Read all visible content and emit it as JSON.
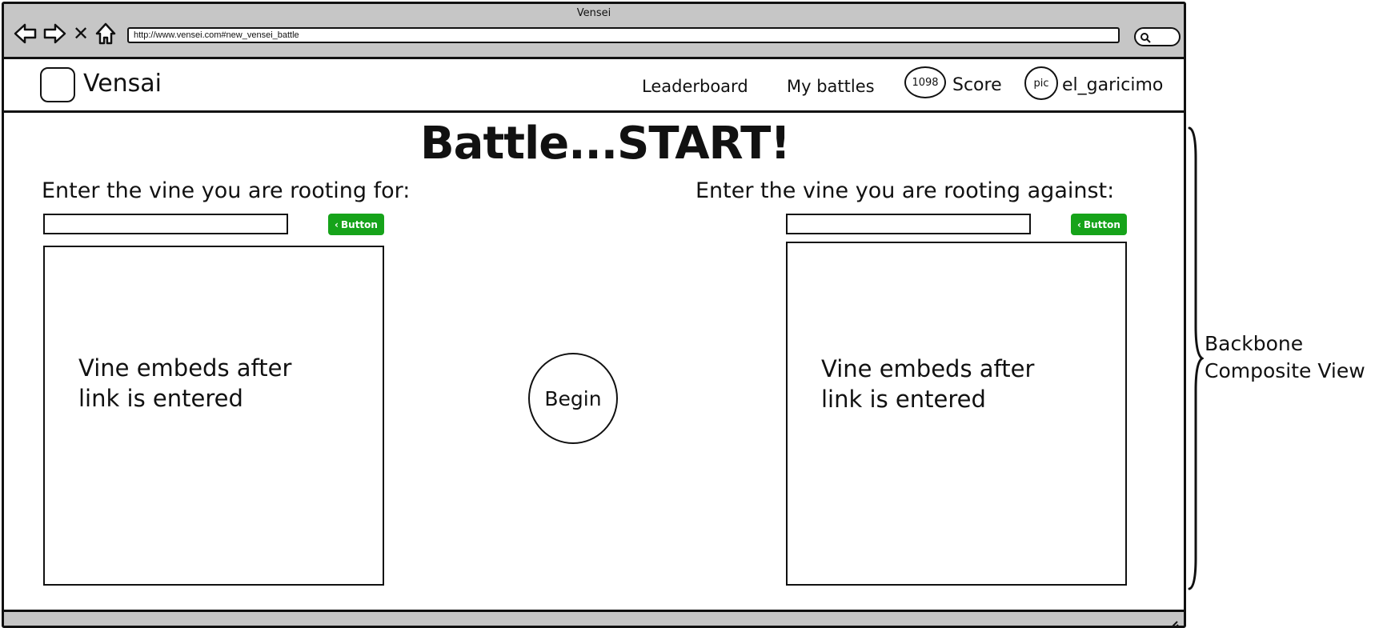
{
  "window": {
    "title": "Vensei",
    "url": "http://www.vensei.com#new_vensei_battle"
  },
  "nav": {
    "brand": "Vensai",
    "links": [
      "Leaderboard",
      "My battles"
    ],
    "score_value": "1098",
    "score_label": "Score",
    "avatar_text": "pic",
    "username": "el_garicimo"
  },
  "main": {
    "heading": "Battle...START!",
    "left": {
      "prompt": "Enter the vine you are rooting for:",
      "button_label": "Button",
      "embed_placeholder": [
        "Vine embeds after",
        "link is entered"
      ]
    },
    "right": {
      "prompt": "Enter the vine you are rooting against:",
      "button_label": "Button",
      "embed_placeholder": [
        "Vine embeds after",
        "link is entered"
      ]
    },
    "begin_label": "Begin"
  },
  "annotation": {
    "lines": [
      "Backbone",
      "Composite View"
    ]
  },
  "colors": {
    "button_green": "#16a31a",
    "chrome_gray": "#c6c6c6"
  }
}
